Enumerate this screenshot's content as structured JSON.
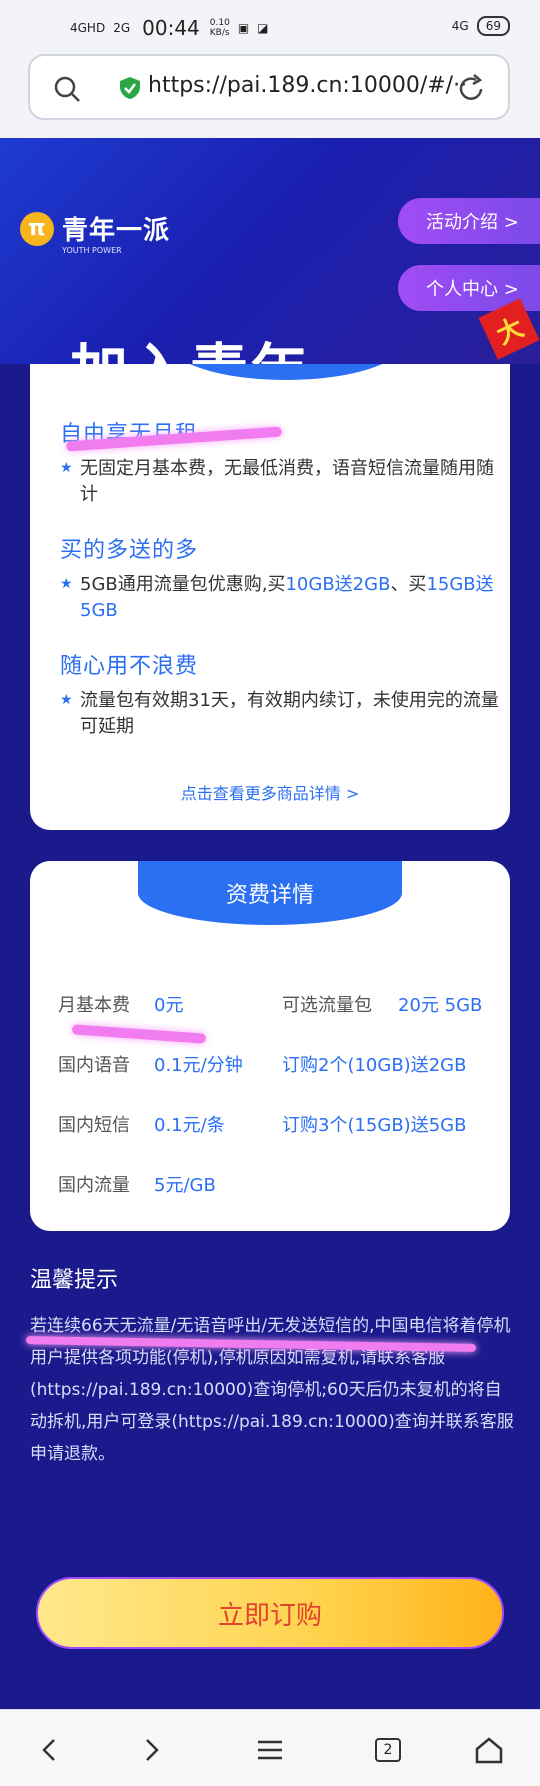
{
  "status": {
    "signal1": "4GHD",
    "signal2": "2G",
    "time": "00:44",
    "speed": "0.10",
    "speed_unit": "KB/s",
    "network_right": "4G",
    "battery": "69"
  },
  "browser": {
    "url": "https://pai.189.cn:10000/#/···",
    "tab_count": "2"
  },
  "hero": {
    "brand": "青年一派",
    "brand_sub": "YOUTH POWER",
    "activity_btn": "活动介绍 >",
    "personal_btn": "个人中心 >",
    "banner_text": "加入青年",
    "ribbon": "大"
  },
  "features": [
    {
      "title": "自由享无月租",
      "desc": "无固定月基本费，无最低消费，语音短信流量随用随计"
    },
    {
      "title": "买的多送的多",
      "desc_pre": "5GB通用流量包优惠购,买",
      "desc_hl1": "10GB送2GB",
      "desc_mid": "、买",
      "desc_hl2": "15GB送5GB"
    },
    {
      "title": "随心用不浪费",
      "desc": "流量包有效期31天，有效期内续订，未使用完的流量可延期"
    }
  ],
  "more_link": "点击查看更多商品详情 >",
  "fee": {
    "title": "资费详情",
    "rows": [
      {
        "label": "月基本费",
        "value": "0元",
        "opt_label": "可选流量包",
        "opt_value": "20元  5GB"
      },
      {
        "label": "国内语音",
        "value": "0.1元/分钟",
        "opt_value": "订购2个(10GB)送2GB"
      },
      {
        "label": "国内短信",
        "value": "0.1元/条",
        "opt_value": "订购3个(15GB)送5GB"
      },
      {
        "label": "国内流量",
        "value": "5元/GB"
      }
    ]
  },
  "tips": {
    "title": "温馨提示",
    "body": "若连续66天无流量/无语音呼出/无发送短信的,中国电信将着停机用户提供各项功能(停机),停机原因如需复机,请联系客服(https://pai.189.cn:10000)查询停机;60天后仍未复机的将自动拆机,用户可登录(https://pai.189.cn:10000)查询并联系客服申请退款。"
  },
  "cta": "立即订购",
  "colors": {
    "page_bg": "#1b1a8c",
    "accent_blue": "#2b6ff3",
    "cta_text": "#e2422e",
    "highlight": "#f07cf0"
  }
}
